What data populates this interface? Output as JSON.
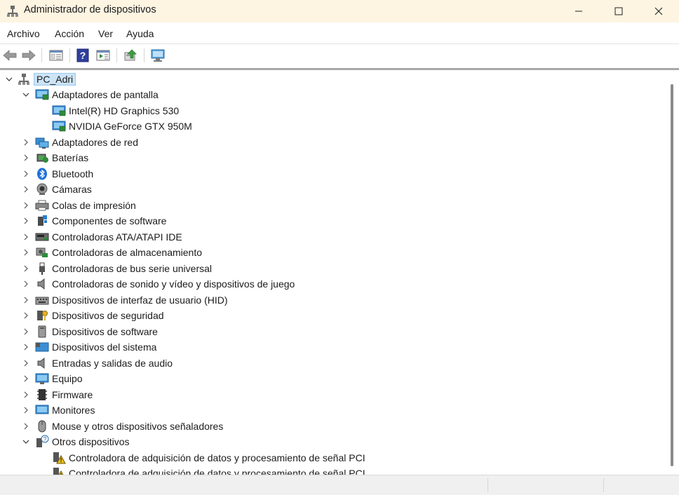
{
  "window": {
    "title": "Administrador de dispositivos",
    "controls": [
      "minimize-icon",
      "maximize-icon",
      "close-icon"
    ]
  },
  "menu": [
    "Archivo",
    "Acción",
    "Ver",
    "Ayuda"
  ],
  "toolbar": [
    "back-arrow-icon",
    "forward-arrow-icon",
    "properties-icon",
    "help-icon",
    "view-icon",
    "update-driver-icon",
    "scan-hardware-icon"
  ],
  "tree": {
    "root": "PC_Adri",
    "categories": [
      {
        "label": "Adaptadores de pantalla",
        "icon": "display-adapter-icon",
        "expanded": true,
        "children": [
          "Intel(R) HD Graphics 530",
          "NVIDIA GeForce GTX 950M"
        ]
      },
      {
        "label": "Adaptadores de red",
        "icon": "network-adapter-icon"
      },
      {
        "label": "Baterías",
        "icon": "battery-icon"
      },
      {
        "label": "Bluetooth",
        "icon": "bluetooth-icon"
      },
      {
        "label": "Cámaras",
        "icon": "camera-icon"
      },
      {
        "label": "Colas de impresión",
        "icon": "printer-icon"
      },
      {
        "label": "Componentes de software",
        "icon": "software-component-icon"
      },
      {
        "label": "Controladoras ATA/ATAPI IDE",
        "icon": "ide-controller-icon"
      },
      {
        "label": "Controladoras de almacenamiento",
        "icon": "storage-controller-icon"
      },
      {
        "label": "Controladoras de bus serie universal",
        "icon": "usb-icon"
      },
      {
        "label": "Controladoras de sonido y vídeo y dispositivos de juego",
        "icon": "speaker-icon"
      },
      {
        "label": "Dispositivos de interfaz de usuario (HID)",
        "icon": "hid-icon"
      },
      {
        "label": "Dispositivos de seguridad",
        "icon": "security-key-icon"
      },
      {
        "label": "Dispositivos de software",
        "icon": "software-device-icon"
      },
      {
        "label": "Dispositivos del sistema",
        "icon": "system-device-icon"
      },
      {
        "label": "Entradas y salidas de audio",
        "icon": "audio-io-icon"
      },
      {
        "label": "Equipo",
        "icon": "computer-icon"
      },
      {
        "label": "Firmware",
        "icon": "firmware-icon"
      },
      {
        "label": "Monitores",
        "icon": "monitor-icon"
      },
      {
        "label": "Mouse y otros dispositivos señaladores",
        "icon": "mouse-icon"
      },
      {
        "label": "Otros dispositivos",
        "icon": "unknown-device-icon",
        "expanded": true,
        "children": [
          "Controladora de adquisición de datos y procesamiento de señal PCI",
          "Controladora de adquisición de datos y procesamiento de señal PCI"
        ]
      }
    ]
  }
}
